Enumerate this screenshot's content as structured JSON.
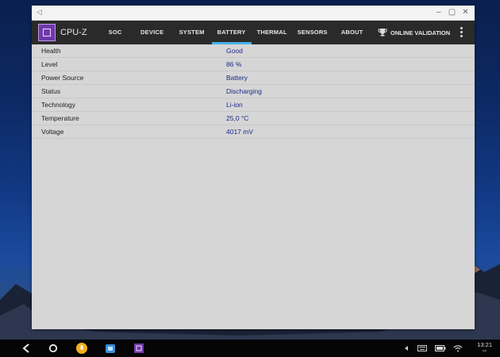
{
  "window": {
    "title": ""
  },
  "app": {
    "name": "CPU-Z",
    "tabs": [
      {
        "label": "SOC"
      },
      {
        "label": "DEVICE"
      },
      {
        "label": "SYSTEM"
      },
      {
        "label": "BATTERY"
      },
      {
        "label": "THERMAL"
      },
      {
        "label": "SENSORS"
      },
      {
        "label": "ABOUT"
      }
    ],
    "active_tab": "BATTERY",
    "online_validation": "ONLINE VALIDATION"
  },
  "battery": {
    "rows": [
      {
        "key": "Health",
        "value": "Good"
      },
      {
        "key": "Level",
        "value": "86 %"
      },
      {
        "key": "Power Source",
        "value": "Battery"
      },
      {
        "key": "Status",
        "value": "Discharging"
      },
      {
        "key": "Technology",
        "value": "Li-ion"
      },
      {
        "key": "Temperature",
        "value": "25,0 °C"
      },
      {
        "key": "Voltage",
        "value": "4017 mV"
      }
    ]
  },
  "taskbar": {
    "time": "13:21",
    "day": "чт",
    "icons": [
      "back-icon",
      "home-icon",
      "mic-app-icon",
      "store-app-icon",
      "cpuz-app-icon"
    ],
    "tray": [
      "menu-arrow-icon",
      "keyboard-icon",
      "battery-icon",
      "wifi-icon"
    ]
  },
  "colors": {
    "accent": "#4ab0e8",
    "value_text": "#1c2a8a",
    "appbar": "#2a2a2a"
  }
}
